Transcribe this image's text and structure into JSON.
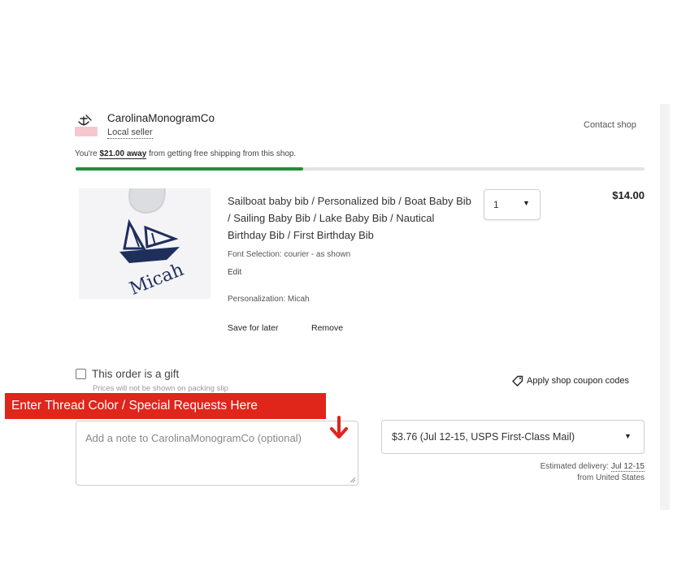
{
  "shop": {
    "name": "CarolinaMonogramCo",
    "badge": "Local seller",
    "contact_label": "Contact shop",
    "logo_icon": "anchor-icon"
  },
  "shipping_progress": {
    "prefix": "You're ",
    "amount": "$21.00 away",
    "suffix": " from getting free shipping from this shop.",
    "progress_fraction": 0.4,
    "bar_color": "#1f8e3a"
  },
  "item": {
    "title": "Sailboat baby bib / Personalized bib / Boat Baby Bib / Sailing Baby Bib / Lake Baby Bib / Nautical Birthday Bib / First Birthday Bib",
    "font_selection": "Font Selection: courier - as shown",
    "edit_label": "Edit",
    "personalization": "Personalization: Micah",
    "image_text": "Micah",
    "save_for_later": "Save for later",
    "remove": "Remove",
    "quantity": "1",
    "price": "$14.00"
  },
  "gift": {
    "label": "This order is a gift",
    "note": "Prices will not be shown on packing slip"
  },
  "coupon": {
    "label": "Apply shop coupon codes",
    "icon": "tag-icon"
  },
  "annotation": {
    "banner_text": "Enter Thread Color / Special Requests Here",
    "banner_color": "#e0251b"
  },
  "note_field": {
    "placeholder": "Add a note to CarolinaMonogramCo (optional)"
  },
  "shipping": {
    "selected": "$3.76 (Jul 12-15, USPS First-Class Mail)",
    "estimate_label": "Estimated delivery: ",
    "estimate_date": "Jul 12-15",
    "origin": "from United States"
  }
}
